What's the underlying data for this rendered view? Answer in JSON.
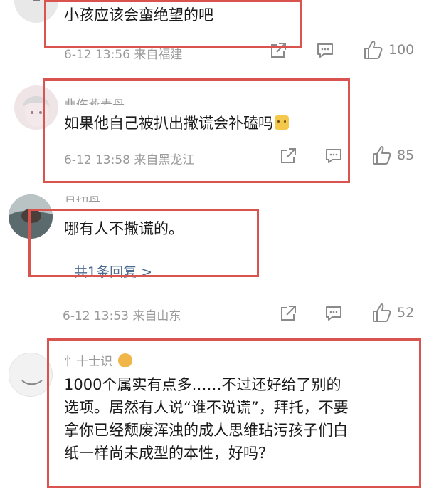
{
  "comments": [
    {
      "text": "小孩应该会蛮绝望的吧",
      "meta": "6-12 13:56 来自福建",
      "likes": "100"
    },
    {
      "username": "悲伤燕麦丹",
      "text": "如果他自己被扒出撒谎会补磕吗",
      "meta": "6-12 13:58 来自黑龙江",
      "likes": "85"
    },
    {
      "username": "月切丹",
      "text": "哪有人不撒谎的。",
      "reply_link": "共1条回复 >",
      "meta": "6-12 13:53 来自山东",
      "likes": "52"
    },
    {
      "username": "忄十士识",
      "text_lines": [
        "1000个属实有点多……不过还好给了别的",
        "选项。居然有人说“谁不说谎”，拜托，不要",
        "拿你已经颓废浑浊的成人思维玷污孩子们白",
        "纸一样尚未成型的本性，好吗？"
      ]
    }
  ],
  "icons": {
    "share": "share-icon",
    "comment": "comment-icon",
    "like": "thumbs-up-icon"
  },
  "colors": {
    "highlight_box": "#d9544f",
    "meta_text": "#9a9a9a",
    "reply_link": "#4a6a92"
  }
}
